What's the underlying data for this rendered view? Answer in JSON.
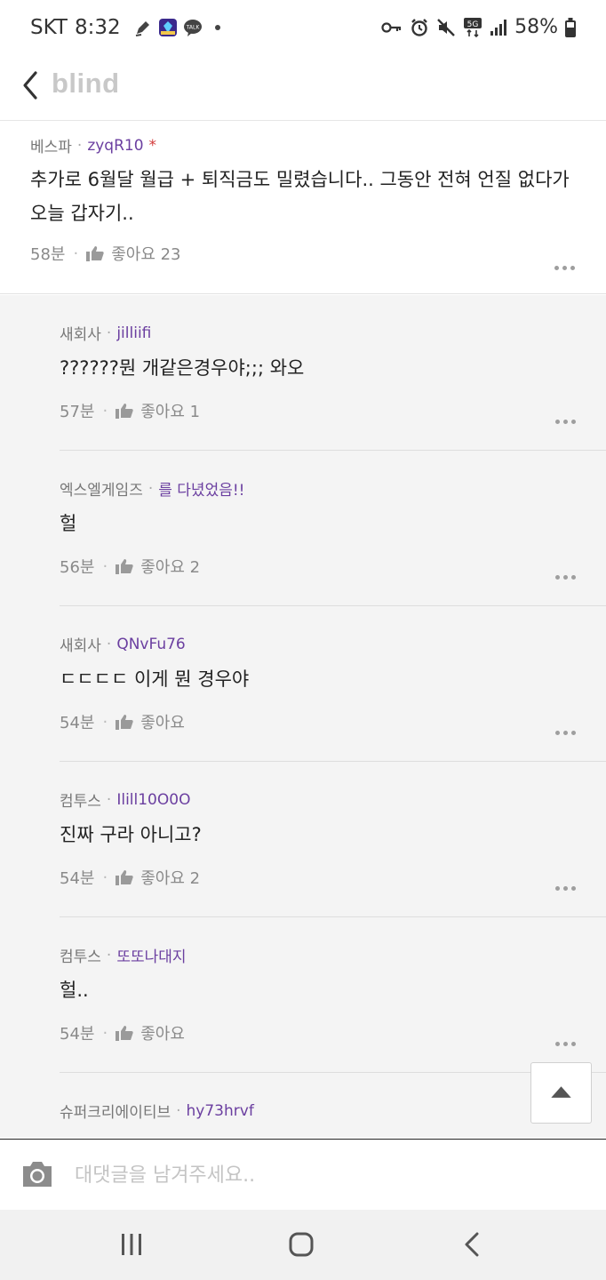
{
  "status_bar": {
    "carrier": "SKT",
    "time": "8:32",
    "battery": "58%",
    "network": "5G",
    "left_icons": [
      "pen-icon",
      "game-app-icon",
      "talk-chat-icon"
    ],
    "right_icons": [
      "key-icon",
      "alarm-icon",
      "mute-icon",
      "network-5g-icon",
      "signal-icon",
      "battery-icon"
    ]
  },
  "header": {
    "brand": "blind",
    "back_icon": "chevron-left-icon"
  },
  "main_comment": {
    "company": "베스파",
    "nickname": "zyqR10",
    "badge": "*",
    "text": "추가로 6월달 월급 + 퇴직금도 밀렸습니다.. 그동안 전혀 언질 없다가 오늘 갑자기..",
    "time": "58분",
    "like_label": "좋아요 23"
  },
  "replies": [
    {
      "company": "새회사",
      "nickname": "jilliifi",
      "text": "??????뭔 개같은경우야;;; 와오",
      "time": "57분",
      "like_label": "좋아요 1"
    },
    {
      "company": "엑스엘게임즈",
      "nickname": "를 다녔었음!!",
      "text": "헐",
      "time": "56분",
      "like_label": "좋아요 2"
    },
    {
      "company": "새회사",
      "nickname": "QNvFu76",
      "text": "ㄷㄷㄷㄷ 이게 뭔 경우야",
      "time": "54분",
      "like_label": "좋아요"
    },
    {
      "company": "컴투스",
      "nickname": "Ilill10O0O",
      "text": "진짜 구라 아니고?",
      "time": "54분",
      "like_label": "좋아요 2"
    },
    {
      "company": "컴투스",
      "nickname": "또또나대지",
      "text": "헐..",
      "time": "54분",
      "like_label": "좋아요"
    },
    {
      "company": "슈퍼크리에이티브",
      "nickname": "hy73hrvf",
      "text": "",
      "time": "",
      "like_label": ""
    }
  ],
  "comment_bar": {
    "placeholder": "대댓글을 남겨주세요.."
  },
  "colors": {
    "nickname": "#6b3fa0",
    "brand": "#c8c8c8",
    "reply_bg": "#f4f4f4"
  }
}
